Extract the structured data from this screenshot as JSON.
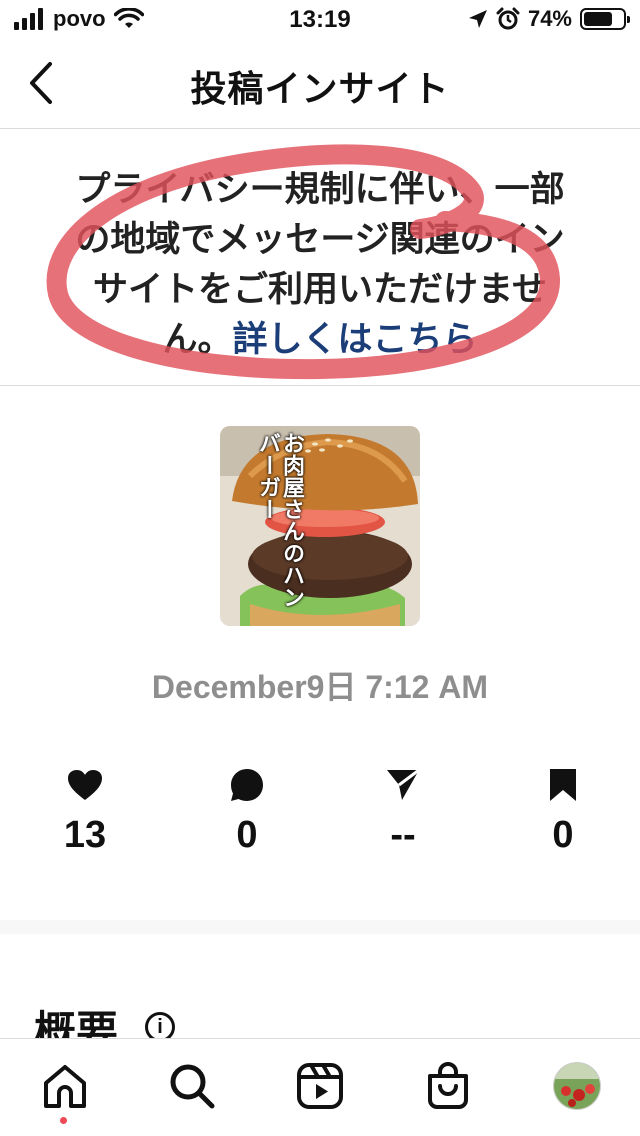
{
  "status_bar": {
    "carrier": "povo",
    "time": "13:19",
    "battery_percent": "74%",
    "battery_level": 0.74,
    "icons": [
      "signal-icon",
      "wifi-icon",
      "location-icon",
      "alarm-icon",
      "battery-icon"
    ]
  },
  "header": {
    "title": "投稿インサイト",
    "back_icon": "chevron-left-icon"
  },
  "notice": {
    "message": "プライバシー規制に伴い、一部の地域でメッセージ関連のインサイトをご利用いただけません。",
    "link_text": "詳しくはこちら",
    "link_color": "#1c3e78",
    "annotation_color": "#e0525b"
  },
  "post": {
    "thumbnail_caption": "お肉屋さんのハンバーガー",
    "date": "December9日 7:12 AM"
  },
  "metrics": [
    {
      "icon": "heart-icon",
      "value": "13"
    },
    {
      "icon": "comment-icon",
      "value": "0"
    },
    {
      "icon": "send-icon",
      "value": "--"
    },
    {
      "icon": "bookmark-icon",
      "value": "0"
    }
  ],
  "overview": {
    "title": "概要",
    "info_icon_glyph": "i"
  },
  "tab_bar": {
    "items": [
      "home-icon",
      "search-icon",
      "reels-icon",
      "shop-icon",
      "profile-avatar"
    ],
    "active": "home-icon",
    "notification_dot_color": "#ed4956"
  }
}
